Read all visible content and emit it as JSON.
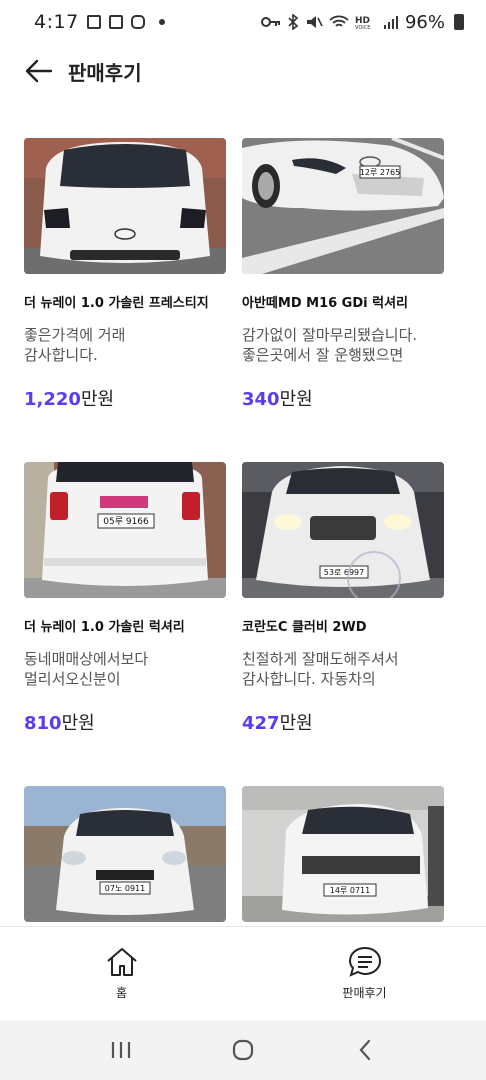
{
  "status": {
    "time": "4:17",
    "battery": "96%"
  },
  "header": {
    "title": "판매후기"
  },
  "cards": [
    {
      "title": "더 뉴레이 1.0 가솔린 프레스티지",
      "desc": "좋은가격에 거래\n감사합니다.",
      "price": "1,220",
      "unit": "만원",
      "image": "white-kia-ray-front"
    },
    {
      "title": "아반떼MD M16 GDi 럭셔리",
      "desc": "감가없이 잘마무리됐습니다.\n좋은곳에서 잘 운행됐으면",
      "price": "340",
      "unit": "만원",
      "image": "white-hyundai-avante-front"
    },
    {
      "title": "더 뉴레이 1.0 가솔린 럭셔리",
      "desc": "동네매매상에서보다\n멀리서오신분이",
      "price": "810",
      "unit": "만원",
      "image": "white-kia-ray-rear"
    },
    {
      "title": "코란도C 클러비 2WD",
      "desc": "친절하게 잘매도해주셔서\n감사합니다. 자동차의",
      "price": "427",
      "unit": "만원",
      "image": "white-korando-c-front"
    },
    {
      "title": "",
      "desc": "",
      "price": "",
      "unit": "",
      "image": "white-chevrolet-spark-front"
    },
    {
      "title": "",
      "desc": "",
      "price": "",
      "unit": "",
      "image": "white-renault-sm6-front"
    }
  ],
  "plates": [
    "12루 2765",
    "05루 9166",
    "53로 6997",
    "07노 0911",
    "14루 0711"
  ],
  "nav": [
    {
      "label": "홈",
      "icon": "home-icon"
    },
    {
      "label": "판매후기",
      "icon": "chat-review-icon"
    }
  ],
  "colors": {
    "accent": "#5b3cf0"
  }
}
